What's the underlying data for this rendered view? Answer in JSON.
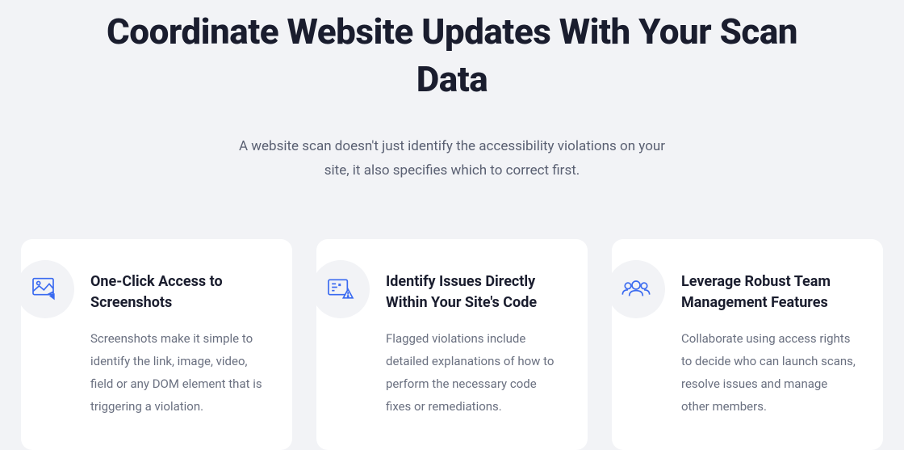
{
  "heading": "Coordinate Website Updates With Your Scan Data",
  "subheading": "A website scan doesn't just identify the accessibility violations on your site, it also specifies which to correct first.",
  "cards": [
    {
      "icon": "screenshot-icon",
      "title": "One-Click Access to Screenshots",
      "description": "Screenshots make it simple to identify the link, image, video, field or any DOM element that is triggering a violation."
    },
    {
      "icon": "code-warning-icon",
      "title": "Identify Issues Directly Within Your Site's Code",
      "description": "Flagged violations include detailed explanations of how to perform the necessary code fixes or remediations."
    },
    {
      "icon": "team-icon",
      "title": "Leverage Robust Team Management Features",
      "description": "Collaborate using access rights to decide who can launch scans, resolve issues and manage other members."
    }
  ],
  "colors": {
    "accent": "#3a6af0",
    "heading": "#1a1d2e",
    "body": "#6a7080",
    "page_bg": "#f2f3f6",
    "card_bg": "#ffffff"
  }
}
